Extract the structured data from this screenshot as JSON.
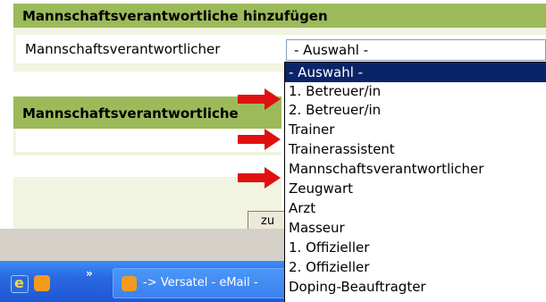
{
  "panel1": {
    "title": "Mannschaftsverantwortliche hinzufügen",
    "field_label": "Mannschaftsverantwortlicher",
    "select_value": "- Auswahl -"
  },
  "panel2": {
    "title": "Mannschaftsverantwortliche"
  },
  "button": {
    "label": "zu"
  },
  "taskbar": {
    "chevron": "»",
    "task_label": "-> Versatel - eMail -"
  },
  "dropdown": {
    "options": [
      "- Auswahl -",
      "1. Betreuer/in",
      "2. Betreuer/in",
      "Trainer",
      "Trainerassistent",
      "Mannschaftsverantwortlicher",
      "Zeugwart",
      "Arzt",
      "Masseur",
      "1. Offizieller",
      "2. Offizieller",
      "Doping-Beauftragter"
    ],
    "selected_index": 0
  },
  "colors": {
    "panel_header": "#9cba5a",
    "panel_bg": "#f0f4e0",
    "selection": "#0a246a",
    "arrow": "#e01010"
  }
}
